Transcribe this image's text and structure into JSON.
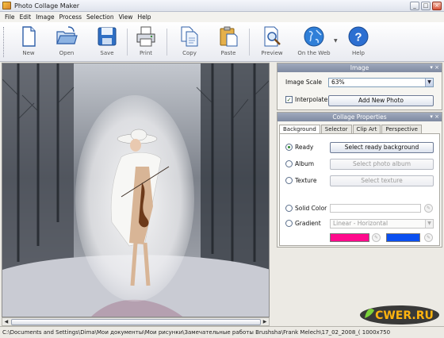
{
  "window": {
    "title": "Photo Collage Maker",
    "buttons": [
      "_",
      "□",
      "×"
    ]
  },
  "menu": [
    "File",
    "Edit",
    "Image",
    "Process",
    "Selection",
    "View",
    "Help"
  ],
  "toolbar": [
    {
      "label": "New",
      "icon": "new-document-icon"
    },
    {
      "label": "Open",
      "icon": "open-folder-icon"
    },
    {
      "label": "Save",
      "icon": "save-disk-icon"
    },
    {
      "label": "Print",
      "icon": "printer-icon"
    },
    {
      "label": "Copy",
      "icon": "copy-icon"
    },
    {
      "label": "Paste",
      "icon": "paste-icon"
    },
    {
      "label": "Preview",
      "icon": "preview-icon"
    },
    {
      "label": "On the Web",
      "icon": "globe-icon"
    },
    {
      "label": "Help",
      "icon": "help-icon"
    }
  ],
  "image_panel": {
    "title": "Image",
    "scale_label": "Image Scale",
    "scale_value": "63%",
    "interpolate_label": "Interpolate",
    "interpolate_checked": true,
    "add_photo_label": "Add New Photo"
  },
  "collage_panel": {
    "title": "Collage Properties",
    "tabs": [
      "Background",
      "Selector",
      "Clip Art",
      "Perspective"
    ],
    "options": [
      {
        "label": "Ready",
        "button": "Select ready background",
        "selected": true,
        "enabled": true
      },
      {
        "label": "Album",
        "button": "Select photo album",
        "selected": false,
        "enabled": false
      },
      {
        "label": "Texture",
        "button": "Select texture",
        "selected": false,
        "enabled": false
      }
    ],
    "solid_color_label": "Solid Color",
    "gradient_label": "Gradient",
    "gradient_value": "Linear - Horizontal",
    "gradient_colors": [
      "#ff0a8c",
      "#0a4ff0"
    ]
  },
  "status": {
    "path": "C:\\Documents and Settings\\Dima\\Мои документы\\Мои рисунки\\Замечательные работы Brushsha\\Frank Melech\\17_02_2008_( 1000x750"
  },
  "watermark": {
    "text": "CWER.RU"
  }
}
